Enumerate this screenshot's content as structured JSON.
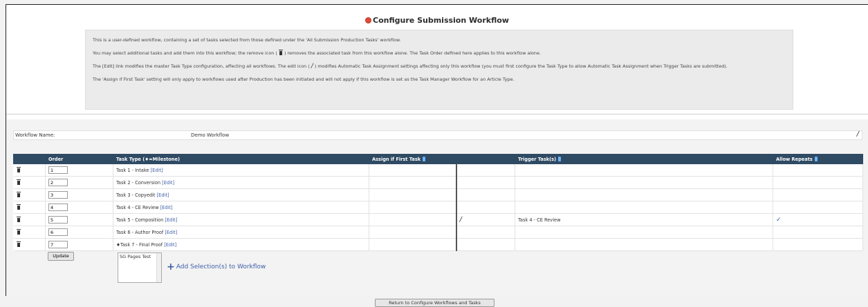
{
  "page": {
    "title": "Configure Submission Workflow"
  },
  "info": {
    "p1": "This is a user-defined workflow, containing a set of tasks selected from those defined under the 'All Submission Production Tasks' workflow.",
    "p2_before": "You may select additional tasks and add them into this workflow; the remove icon (",
    "p2_after": ") removes the associated task from this workflow alone. The Task Order defined here applies to this workflow alone.",
    "p3_before": "The [Edit] link modifies the master Task Type configuration, affecting all workflows. The edit icon (",
    "p3_after": ") modifies Automatic Task Assignment settings affecting only this workflow (you must first configure the Task Type to allow Automatic Task Assignment when Trigger Tasks are submitted).",
    "p4": "The 'Assign if First Task' setting will only apply to workflows used after Production has been initiated and will not apply if this workflow is set as the Task Manager Workflow for an Article Type."
  },
  "workflow": {
    "label": "Workflow Name:",
    "name": "Demo Workflow"
  },
  "table": {
    "headers": {
      "order": "Order",
      "task_type": "Task Type (♦=Milestone)",
      "assign_first": "Assign if First Task",
      "trigger": "Trigger Task(s)",
      "allow_repeats": "Allow Repeats"
    },
    "edit_label": "[Edit]",
    "rows": [
      {
        "order": "1",
        "task": "Task 1 - Intake",
        "trigger": "",
        "allow_repeats": ""
      },
      {
        "order": "2",
        "task": "Task 2 - Conversion",
        "trigger": "",
        "allow_repeats": ""
      },
      {
        "order": "3",
        "task": "Task 3 - Copyedit",
        "trigger": "",
        "allow_repeats": ""
      },
      {
        "order": "4",
        "task": "Task 4 - CE Review",
        "trigger": "",
        "allow_repeats": ""
      },
      {
        "order": "5",
        "task": "Task 5 - Composition",
        "trigger": "Task 4 - CE Review",
        "allow_repeats": "✓"
      },
      {
        "order": "6",
        "task": "Task 6 - Author Proof",
        "trigger": "",
        "allow_repeats": ""
      },
      {
        "order": "7",
        "task": "♦Task 7 - Final Proof",
        "trigger": "",
        "allow_repeats": ""
      }
    ]
  },
  "controls": {
    "update": "Update",
    "list_option": "SG Pages Test",
    "add_selection": "Add Selection(s) to Workflow",
    "return": "Return to Configure Workflows and Tasks"
  },
  "colors": {
    "header_bg": "#2f4a63",
    "link": "#3d5ea8",
    "title_icon": "#e04b3a"
  }
}
